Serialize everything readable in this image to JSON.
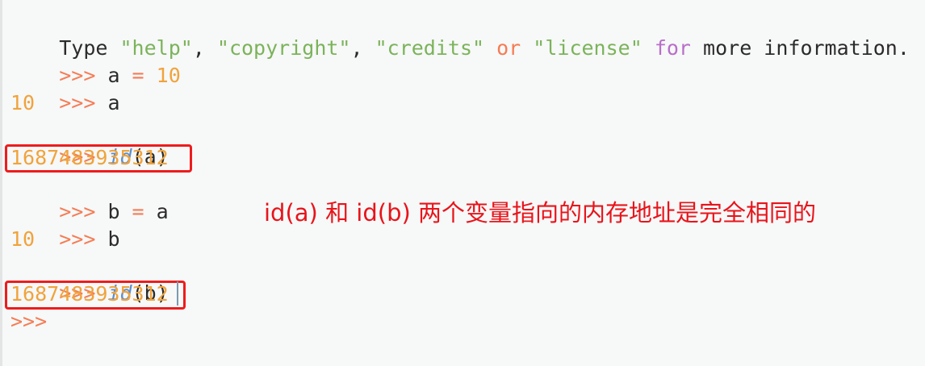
{
  "console": {
    "banner": {
      "type_word": "Type ",
      "help": "\"help\"",
      "sep1": ", ",
      "copyright": "\"copyright\"",
      "sep2": ", ",
      "credits": "\"credits\"",
      "sep3": " ",
      "or": "or",
      "sep4": " ",
      "license": "\"license\"",
      "sep5": " ",
      "for": "for",
      "tail": " more information."
    },
    "prompt": ">>> ",
    "prompt_bare": ">>>",
    "lines": {
      "l1_var": "a",
      "l1_eq": " = ",
      "l1_val": "10",
      "l2_expr": "a",
      "l3_out": "10",
      "l4_fn": "id",
      "l4_args": "(a)",
      "l5_out": "1687483935312",
      "l6_lhs": "b",
      "l6_eq": " = ",
      "l6_rhs": "a",
      "l7_expr": "b",
      "l8_out": "10",
      "l9_fn": "id",
      "l9_args": "(b)",
      "l10_out": "1687483935312"
    }
  },
  "annotation": {
    "text": "id(a) 和 id(b) 两个变量指向的内存地址是完全相同的"
  },
  "colors": {
    "prompt": "#f57c54",
    "string": "#7bb35a",
    "number": "#f0a33c",
    "function": "#5b8fd0",
    "keyword_for": "#b86fc9",
    "annotation": "#e8141a"
  }
}
